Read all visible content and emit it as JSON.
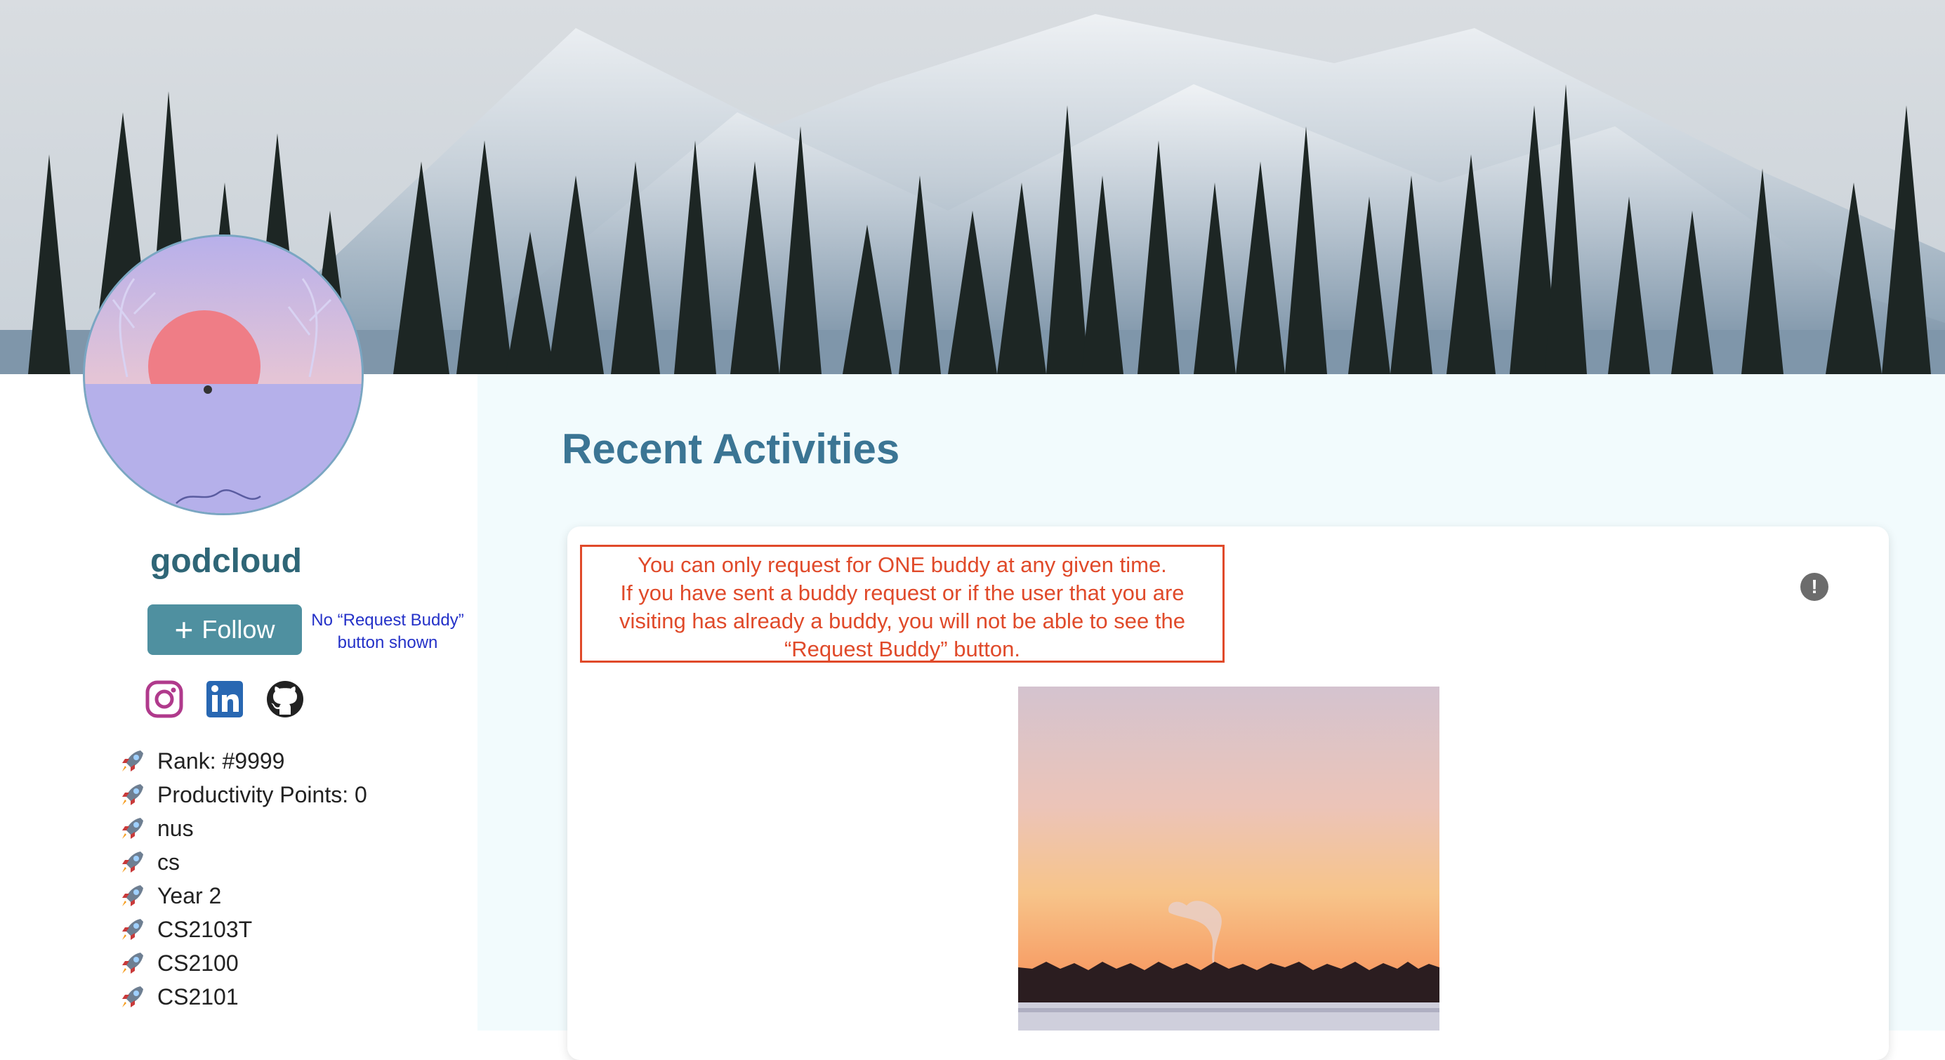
{
  "profile": {
    "username": "godcloud",
    "follow_label": "Follow",
    "note_line1": "No “Request Buddy”",
    "note_line2": "button shown",
    "socials": [
      "instagram-icon",
      "linkedin-icon",
      "github-icon"
    ],
    "info": [
      "Rank: #9999",
      "Productivity Points: 0",
      "nus",
      "cs",
      "Year 2",
      "CS2103T",
      "CS2100",
      "CS2101"
    ]
  },
  "activities": {
    "title": "Recent Activities",
    "warning_lines": [
      "You can only request for ONE buddy at any given time.",
      "If you have sent a buddy request or if the user that you are",
      "visiting has already a buddy, you will not be able to see the",
      "“Request Buddy” button."
    ]
  },
  "colors": {
    "primary": "#4f90a0",
    "title": "#3b7594",
    "username": "#2f6677",
    "warning": "#e04a2a",
    "note": "#2431c8",
    "main_bg": "#f2fbfd"
  }
}
